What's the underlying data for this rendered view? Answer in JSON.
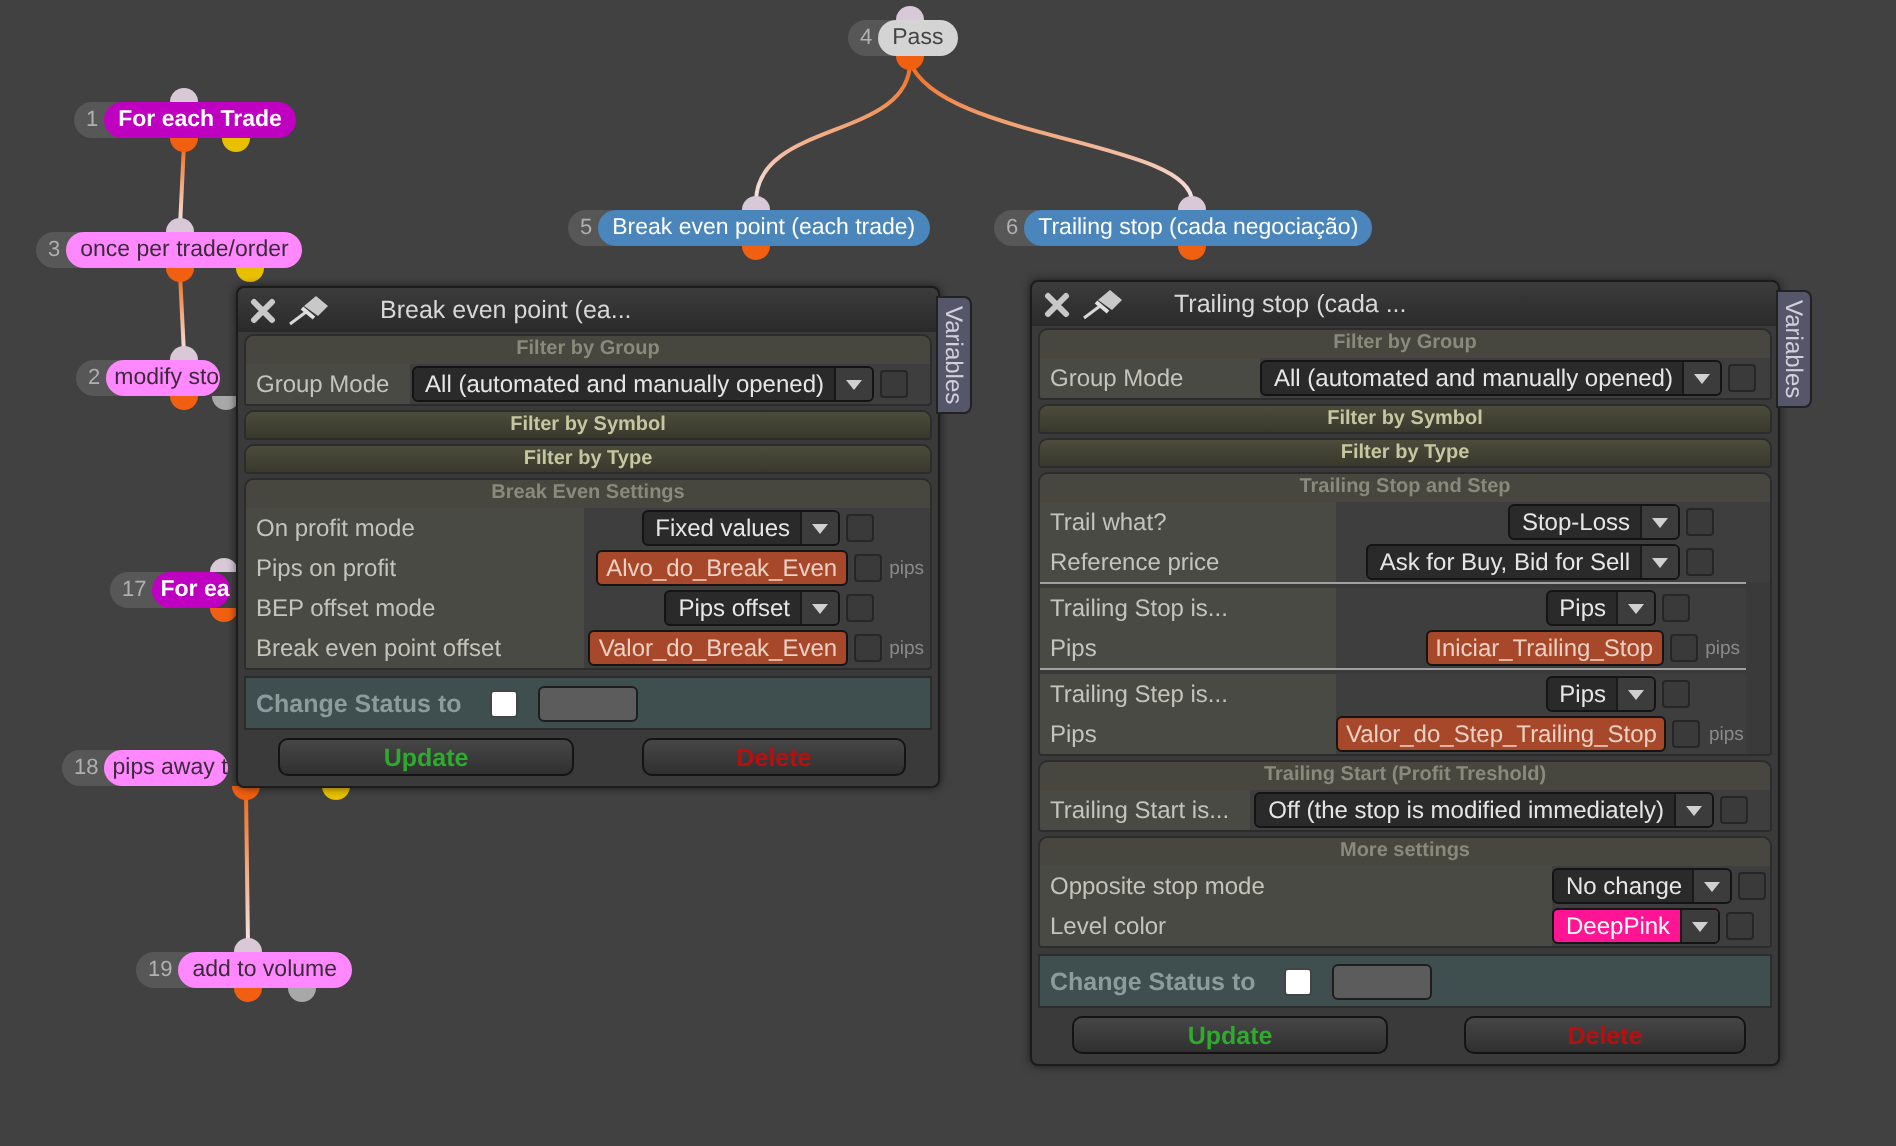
{
  "canvas": {
    "nodes": [
      {
        "number": "1",
        "label": "For each Trade",
        "kind": "loop"
      },
      {
        "number": "3",
        "label": "once per trade/order",
        "kind": "condition"
      },
      {
        "number": "2",
        "label": "modify sto",
        "kind": "condition"
      },
      {
        "number": "17",
        "label": "For ea",
        "kind": "loop"
      },
      {
        "number": "18",
        "label": "pips away t",
        "kind": "condition"
      },
      {
        "number": "19",
        "label": "add to volume",
        "kind": "condition"
      },
      {
        "number": "4",
        "label": "Pass",
        "kind": "pass"
      },
      {
        "number": "5",
        "label": "Break even point (each trade)",
        "kind": "action"
      },
      {
        "number": "6",
        "label": "Trailing stop (cada negociação)",
        "kind": "action"
      }
    ]
  },
  "windows": [
    {
      "title": "Break even point (ea...",
      "side_tab": "Variables",
      "sections": [
        {
          "title": "Filter by Group",
          "expanded": true,
          "groups": [
            [
              {
                "label": "Group Mode",
                "control": {
                  "kind": "select",
                  "value": "All (automated and manually opened)"
                },
                "checked": false
              }
            ]
          ]
        },
        {
          "title": "Filter by Symbol",
          "expanded": false
        },
        {
          "title": "Filter by Type",
          "expanded": false
        },
        {
          "title": "Break Even Settings",
          "expanded": true,
          "groups": [
            [
              {
                "label": "On profit mode",
                "control": {
                  "kind": "select",
                  "value": "Fixed values"
                },
                "checked": false
              },
              {
                "label": "Pips on profit",
                "control": {
                  "kind": "variable",
                  "value": "Alvo_do_Break_Even",
                  "unit": "pips"
                },
                "checked": false
              },
              {
                "label": "BEP offset mode",
                "control": {
                  "kind": "select",
                  "value": "Pips offset"
                },
                "checked": false
              },
              {
                "label": "Break even point offset",
                "control": {
                  "kind": "variable",
                  "value": "Valor_do_Break_Even",
                  "unit": "pips"
                },
                "checked": false
              }
            ]
          ]
        }
      ],
      "status_label": "Change Status to",
      "status_checked": false,
      "buttons": [
        {
          "label": "Update",
          "kind": "update"
        },
        {
          "label": "Delete",
          "kind": "delete"
        }
      ]
    },
    {
      "title": "Trailing stop (cada ...",
      "side_tab": "Variables",
      "sections": [
        {
          "title": "Filter by Group",
          "expanded": true,
          "groups": [
            [
              {
                "label": "Group Mode",
                "control": {
                  "kind": "select",
                  "value": "All (automated and manually opened)"
                },
                "checked": false
              }
            ]
          ]
        },
        {
          "title": "Filter by Symbol",
          "expanded": false
        },
        {
          "title": "Filter by Type",
          "expanded": false
        },
        {
          "title": "Trailing Stop and Step",
          "expanded": true,
          "groups": [
            [
              {
                "label": "Trail what?",
                "control": {
                  "kind": "select",
                  "value": "Stop-Loss"
                },
                "checked": false
              },
              {
                "label": "Reference price",
                "control": {
                  "kind": "select",
                  "value": "Ask for Buy, Bid for Sell"
                },
                "checked": false
              }
            ],
            [
              {
                "label": "Trailing Stop is...",
                "control": {
                  "kind": "select",
                  "value": "Pips"
                },
                "checked": false
              },
              {
                "label": "Pips",
                "control": {
                  "kind": "variable",
                  "value": "Iniciar_Trailing_Stop",
                  "unit": "pips"
                },
                "checked": false
              }
            ],
            [
              {
                "label": "Trailing Step is...",
                "control": {
                  "kind": "select",
                  "value": "Pips"
                },
                "checked": false
              },
              {
                "label": "Pips",
                "control": {
                  "kind": "variable",
                  "value": "Valor_do_Step_Trailing_Stop",
                  "unit": "pips"
                },
                "checked": false
              }
            ]
          ]
        },
        {
          "title": "Trailing Start (Profit Treshold)",
          "expanded": true,
          "groups": [
            [
              {
                "label": "Trailing Start is...",
                "control": {
                  "kind": "select",
                  "value": "Off (the stop is modified immediately)"
                },
                "checked": false
              }
            ]
          ]
        },
        {
          "title": "More settings",
          "expanded": true,
          "groups": [
            [
              {
                "label": "Opposite stop mode",
                "control": {
                  "kind": "select",
                  "value": "No change"
                },
                "checked": false
              },
              {
                "label": "Level color",
                "control": {
                  "kind": "select",
                  "value": "DeepPink",
                  "color": "#ff1493"
                },
                "checked": false
              }
            ]
          ]
        }
      ],
      "status_label": "Change Status to",
      "status_checked": false,
      "buttons": [
        {
          "label": "Update",
          "kind": "update"
        },
        {
          "label": "Delete",
          "kind": "delete"
        }
      ]
    }
  ]
}
